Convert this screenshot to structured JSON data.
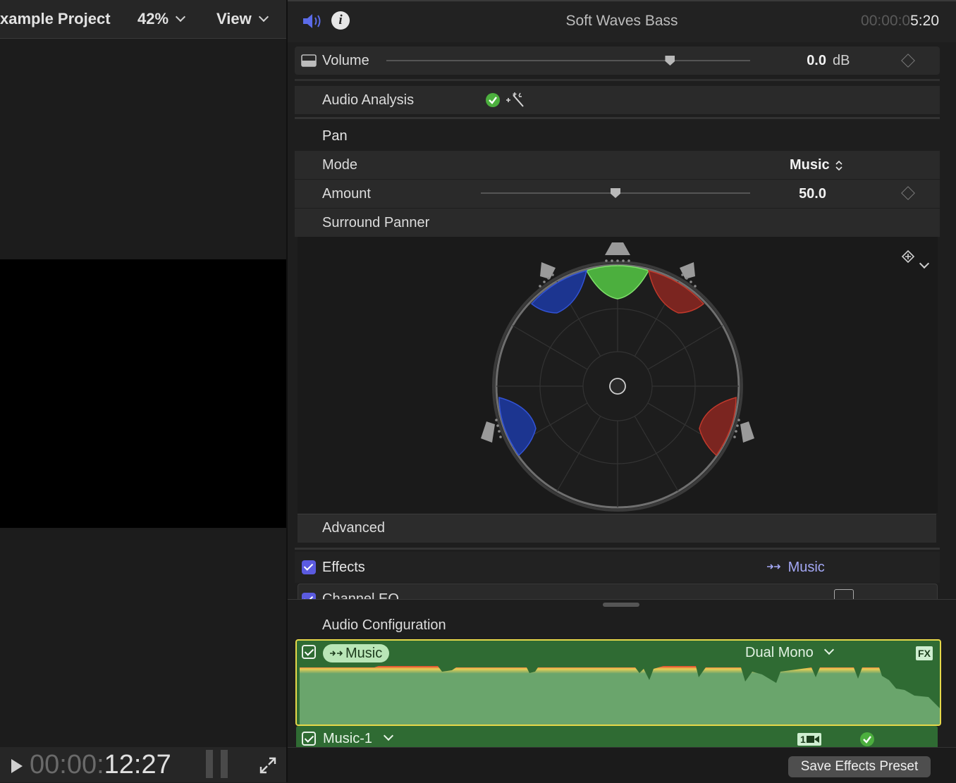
{
  "viewer": {
    "project_name": "xample Project",
    "zoom": "42%",
    "view_label": "View",
    "timecode_dim": "00:00:",
    "timecode": "12:27"
  },
  "inspector": {
    "clip_title": "Soft Waves Bass",
    "timecode_dim": "00:00:0",
    "timecode": "5:20",
    "volume": {
      "label": "Volume",
      "value": "0.0",
      "unit": "dB",
      "level_fraction": 0.78
    },
    "audio_analysis": {
      "label": "Audio Analysis"
    },
    "pan": {
      "section_label": "Pan",
      "mode_label": "Mode",
      "mode_value": "Music",
      "amount_label": "Amount",
      "amount_value": "50.0",
      "amount_fraction": 0.5,
      "surround_panner_label": "Surround Panner"
    },
    "advanced_label": "Advanced",
    "effects": {
      "label": "Effects",
      "role": "Music",
      "partial_item": "Channel EQ"
    }
  },
  "audio_configuration": {
    "title": "Audio Configuration",
    "lanes": [
      {
        "role": "Music",
        "config": "Dual Mono",
        "fx": "FX"
      },
      {
        "name": "Music-1",
        "channel_badge": "1"
      }
    ]
  },
  "footer": {
    "save_preset_label": "Save Effects Preset"
  },
  "colors": {
    "accent": "#5b5be0",
    "lane_green": "#2f6b33",
    "selection_yellow": "#e6d84a",
    "panner_green": "#4caf3e",
    "panner_red": "#8b2a25",
    "panner_blue": "#1f3b99"
  },
  "icons": [
    "speaker-icon",
    "info-icon",
    "play-icon",
    "fullscreen-icon",
    "checkmark-icon",
    "magic-wand-icon",
    "keyframe-icon",
    "role-arrow-icon",
    "fx-icon",
    "camera-icon"
  ]
}
